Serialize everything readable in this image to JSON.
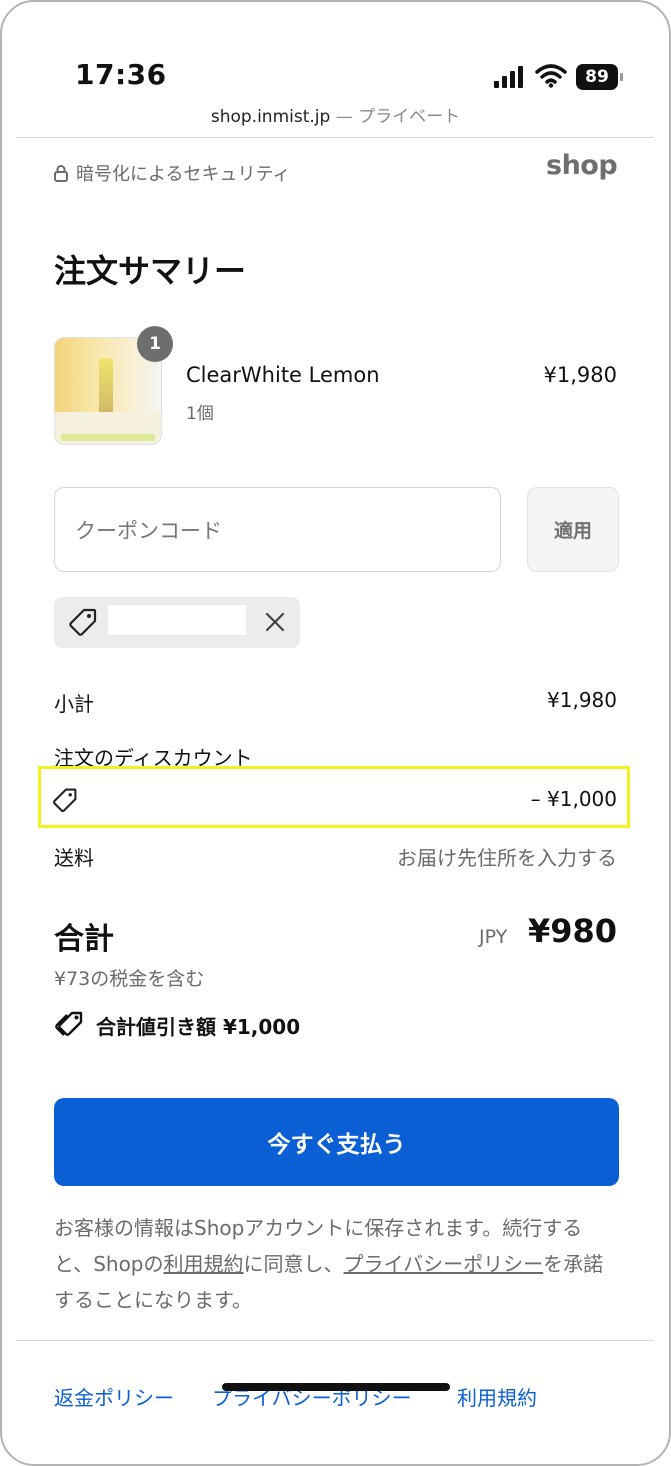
{
  "status_bar": {
    "time": "17:36",
    "battery": "89",
    "url": "shop.inmist.jp",
    "url_suffix": " — プライベート"
  },
  "header": {
    "secure_label": "暗号化によるセキュリティ",
    "logo": "shop"
  },
  "summary": {
    "title": "注文サマリー",
    "item": {
      "name": "ClearWhite Lemon",
      "qty_label": "1個",
      "qty_badge": "1",
      "price": "¥1,980"
    }
  },
  "coupon": {
    "placeholder": "クーポンコード",
    "apply_label": "適用"
  },
  "breakdown": {
    "subtotal_label": "小計",
    "subtotal_value": "¥1,980",
    "discount_label": "注文のディスカウント",
    "discount_value": "– ¥1,000",
    "shipping_label": "送料",
    "shipping_value": "お届け先住所を入力する"
  },
  "total": {
    "label": "合計",
    "currency": "JPY",
    "value": "¥980",
    "tax_note": "¥73の税金を含む",
    "savings": "合計値引き額 ¥1,000"
  },
  "pay_button": "今すぐ支払う",
  "legal": {
    "part1": "お客様の情報はShopアカウントに保存されます。続行すると、Shopの",
    "terms_link": "利用規約",
    "part2": "に同意し、",
    "privacy_link": "プライバシーポリシー",
    "part3": "を承諾することになります。"
  },
  "footer": {
    "refund": "返金ポリシー",
    "privacy": "プライバシーポリシー",
    "terms": "利用規約"
  },
  "colors": {
    "accent": "#0b5fd4",
    "highlight": "#f2f21e"
  }
}
